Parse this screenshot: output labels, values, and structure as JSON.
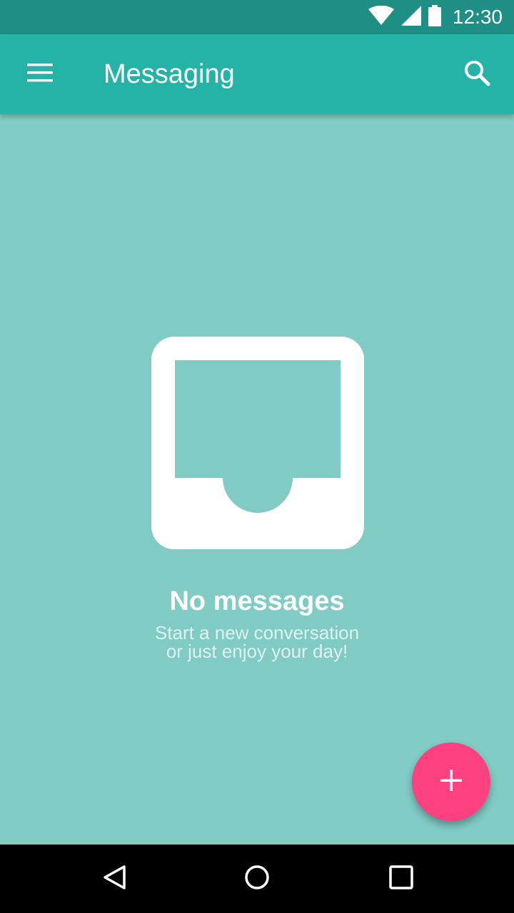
{
  "status_bar": {
    "time": "12:30",
    "icons": [
      "wifi-icon",
      "cell-signal-icon",
      "battery-icon"
    ]
  },
  "app_bar": {
    "title": "Messaging",
    "left_icon": "hamburger-menu-icon",
    "right_icon": "search-icon"
  },
  "empty_state": {
    "icon": "inbox-icon",
    "title": "No messages",
    "subtitle_line1": "Start a new conversation",
    "subtitle_line2": "or just enjoy your day!"
  },
  "fab": {
    "icon": "plus-icon"
  },
  "nav_bar": {
    "buttons": [
      "back-icon",
      "home-icon",
      "recents-icon"
    ]
  },
  "colors": {
    "status_bar": "#1F8E85",
    "app_bar": "#24B3A6",
    "background": "#80CBC4",
    "fab": "#FF4081",
    "nav_bar": "#000000",
    "foreground": "#FFFFFF"
  }
}
